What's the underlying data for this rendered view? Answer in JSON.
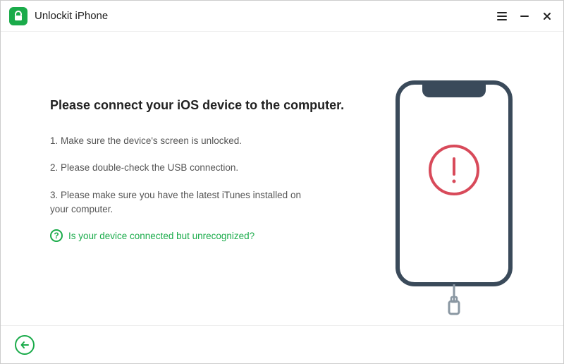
{
  "titlebar": {
    "app_name": "Unlockit iPhone"
  },
  "content": {
    "heading": "Please connect your iOS device to the computer.",
    "steps": [
      "1. Make sure the device's screen is unlocked.",
      "2. Please double-check the USB connection.",
      "3. Please make sure you have the latest iTunes installed on your computer."
    ],
    "help_link": "Is your device connected but unrecognized?"
  },
  "icons": {
    "app": "lock-icon",
    "menu": "hamburger-icon",
    "minimize": "minimize-icon",
    "close": "close-icon",
    "help": "question-icon",
    "back": "back-arrow-icon",
    "phone_alert": "exclamation-icon"
  },
  "colors": {
    "accent": "#1aab4a",
    "alert": "#d84a5a",
    "phone_stroke": "#3a4a5a"
  }
}
